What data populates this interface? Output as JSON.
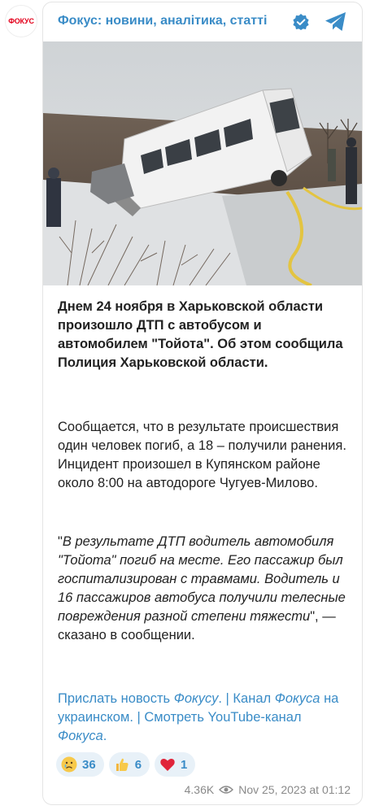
{
  "channel": {
    "avatar_text": "ФОКУС",
    "title": "Фокус: новини, аналітика, статті"
  },
  "post": {
    "p1": "Днем 24 ноября в Харьковской области произошло ДТП с автобусом и автомобилем \"Тойота\". Об этом сообщила Полиция Харьковской области.",
    "p2": "Сообщается, что в результате происшествия один человек погиб, а 18 – получили ранения. Инцидент произошел в Купянском районе около 8:00 на автодороге Чугуев-Милово.",
    "p3_open": "\"",
    "p3_italic": "В результате ДТП водитель автомобиля \"Тойота\" погиб на месте. Его пассажир был госпитализирован с травмами. Водитель и 16 пассажиров автобуса получили телесные повреждения разной степени тяжести",
    "p3_close": "\", — сказано в сообщении.",
    "links": {
      "l1a": "Прислать новость ",
      "l1b": "Фокусу",
      "sep1": ". | ",
      "l2a": "Канал ",
      "l2b": "Фокуса",
      "l2c": " на украинском",
      "sep2": ". | ",
      "l3a": "Смотреть YouTube-канал ",
      "l3b": "Фокуса",
      "end": "."
    }
  },
  "reactions": [
    {
      "emoji": "crying-face-icon",
      "count": "36"
    },
    {
      "emoji": "thumbs-up-icon",
      "count": "6"
    },
    {
      "emoji": "red-heart-icon",
      "count": "1"
    }
  ],
  "meta": {
    "views": "4.36K",
    "datetime": "Nov 25, 2023 at 01:12"
  },
  "colors": {
    "link": "#3a8cc7",
    "brand": "#e3001b",
    "reaction_bg": "#e8f1f8"
  }
}
